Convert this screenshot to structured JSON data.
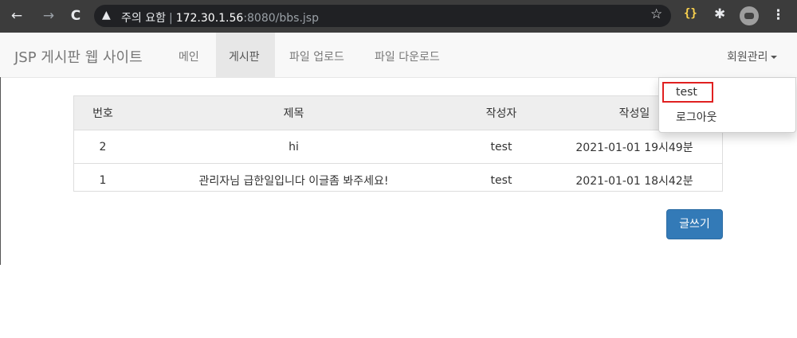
{
  "browser": {
    "back_icon": "←",
    "forward_icon": "→",
    "reload_icon": "C",
    "warning_icon": "▲",
    "security_label": "주의 요함",
    "separator": "|",
    "url_host": "172.30.1.56",
    "url_rest": ":8080/bbs.jsp",
    "star_icon": "☆",
    "extension_json_label": "{}",
    "puzzle_icon": "✱",
    "menu_icon": "⋮"
  },
  "navbar": {
    "brand": "JSP 게시판 웹 사이트",
    "links": [
      "메인",
      "게시판",
      "파일 업로드",
      "파일 다운로드"
    ],
    "member_menu": "회원관리"
  },
  "dropdown": {
    "items": [
      "test",
      "로그아웃"
    ]
  },
  "table": {
    "headers": [
      "번호",
      "제목",
      "작성자",
      "작성일"
    ],
    "rows": [
      [
        "2",
        "hi",
        "test",
        "2021-01-01 19시49분"
      ],
      [
        "1",
        "관리자님 급한일입니다 이글좀 봐주세요!",
        "test",
        "2021-01-01 18시42분"
      ]
    ]
  },
  "write_button": "글쓰기",
  "colors": {
    "navbar_bg": "#f8f8f8",
    "primary": "#337ab7",
    "highlight_box": "#e02020"
  }
}
